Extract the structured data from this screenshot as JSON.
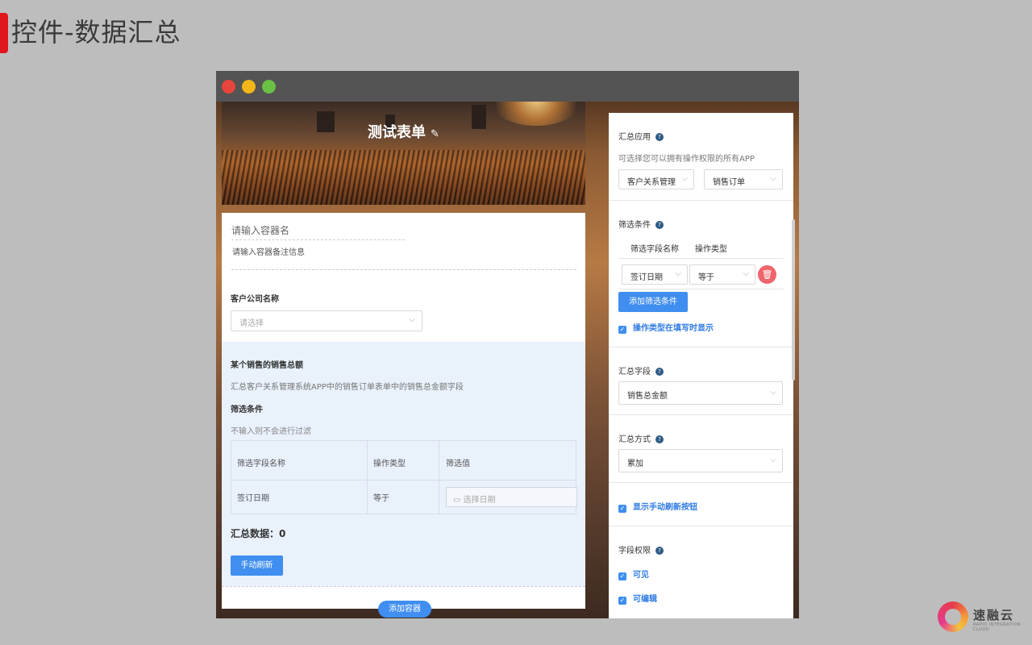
{
  "slide": {
    "title": "控件-数据汇总"
  },
  "form": {
    "banner_title": "测试表单",
    "container_name_placeholder": "请输入容器名",
    "container_note_placeholder": "请输入容器备注信息",
    "customer_label": "客户公司名称",
    "customer_placeholder": "请选择",
    "summary": {
      "title": "某个销售的销售总额",
      "description": "汇总客户关系管理系统APP中的销售订单表单中的销售总金额字段",
      "filter_title": "筛选条件",
      "filter_hint": "不输入则不会进行过滤",
      "table_headers": [
        "筛选字段名称",
        "操作类型",
        "筛选值"
      ],
      "row": {
        "field": "签订日期",
        "operator": "等于",
        "value_placeholder": "选择日期"
      },
      "data_label": "汇总数据：",
      "data_value": "0",
      "refresh_button": "手动刷新"
    },
    "add_container_button": "添加容器"
  },
  "panel": {
    "summary_app": {
      "title": "汇总应用",
      "hint": "可选择您可以拥有操作权限的所有APP",
      "app_value": "客户关系管理",
      "form_value": "销售订单"
    },
    "filters": {
      "title": "筛选条件",
      "headers": [
        "筛选字段名称",
        "操作类型"
      ],
      "field_value": "签订日期",
      "operator_value": "等于",
      "add_button": "添加筛选条件",
      "show_operator_label": "操作类型在填写时显示"
    },
    "summary_field": {
      "title": "汇总字段",
      "value": "销售总金额"
    },
    "summary_method": {
      "title": "汇总方式",
      "value": "累加"
    },
    "show_refresh_label": "显示手动刷新按钮",
    "permissions": {
      "title": "字段权限",
      "visible_label": "可见",
      "editable_label": "可编辑"
    }
  },
  "logo": {
    "name": "速融云",
    "tagline": "RAPID INTEGRATION CLOUD"
  }
}
